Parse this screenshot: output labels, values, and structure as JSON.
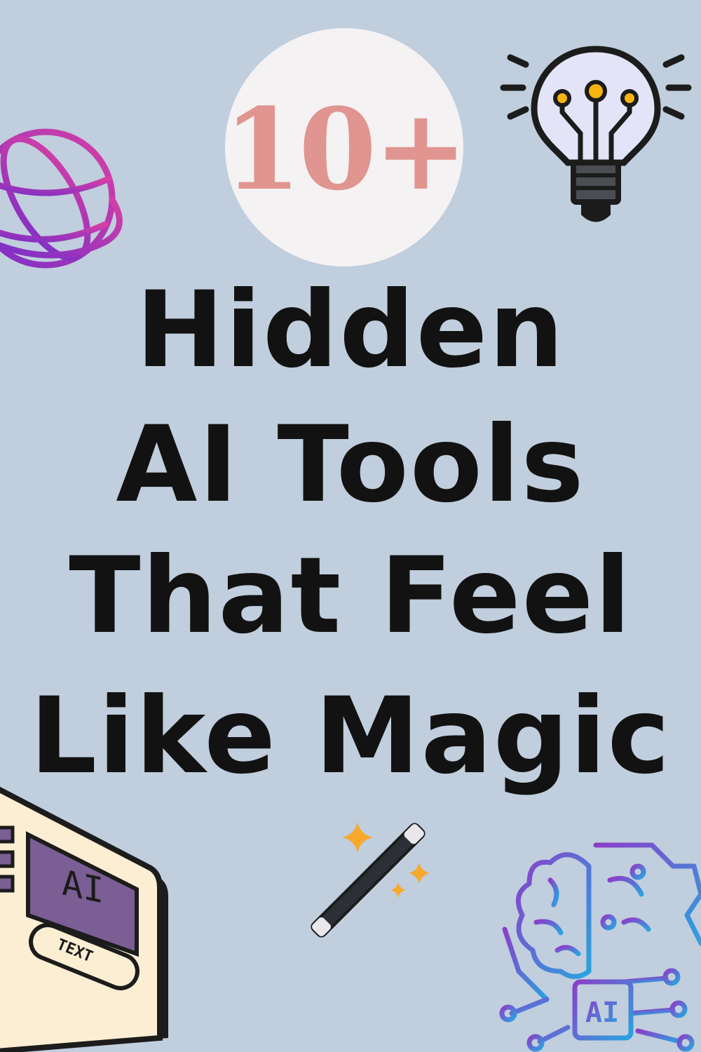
{
  "colors": {
    "background": "#c0cedd",
    "badge_fill": "#f5f2f3",
    "badge_text": "#e09590",
    "title_text": "#121212",
    "globe_start": "#7b2fc7",
    "globe_end": "#d73fa5",
    "bulb_glass": "#e3e4f7",
    "bulb_node": "#f7b40f",
    "wand_star": "#f7a92b",
    "tablet_body": "#fbeed2",
    "tablet_screen": "#7a5e94",
    "brain_start": "#8b3fc9",
    "brain_end": "#2aa3e0"
  },
  "badge": {
    "text": "10+"
  },
  "title": {
    "line1": "Hidden",
    "line2": "AI Tools",
    "line3": "That Feel",
    "line4": "Like Magic"
  },
  "tablet": {
    "screen_label": "AI",
    "button_label": "TEXT"
  },
  "brain": {
    "chip_label": "AI"
  },
  "icons": [
    "globe-icon",
    "lightbulb-icon",
    "magic-wand-icon",
    "ai-text-tablet-icon",
    "ai-brain-circuit-icon"
  ]
}
